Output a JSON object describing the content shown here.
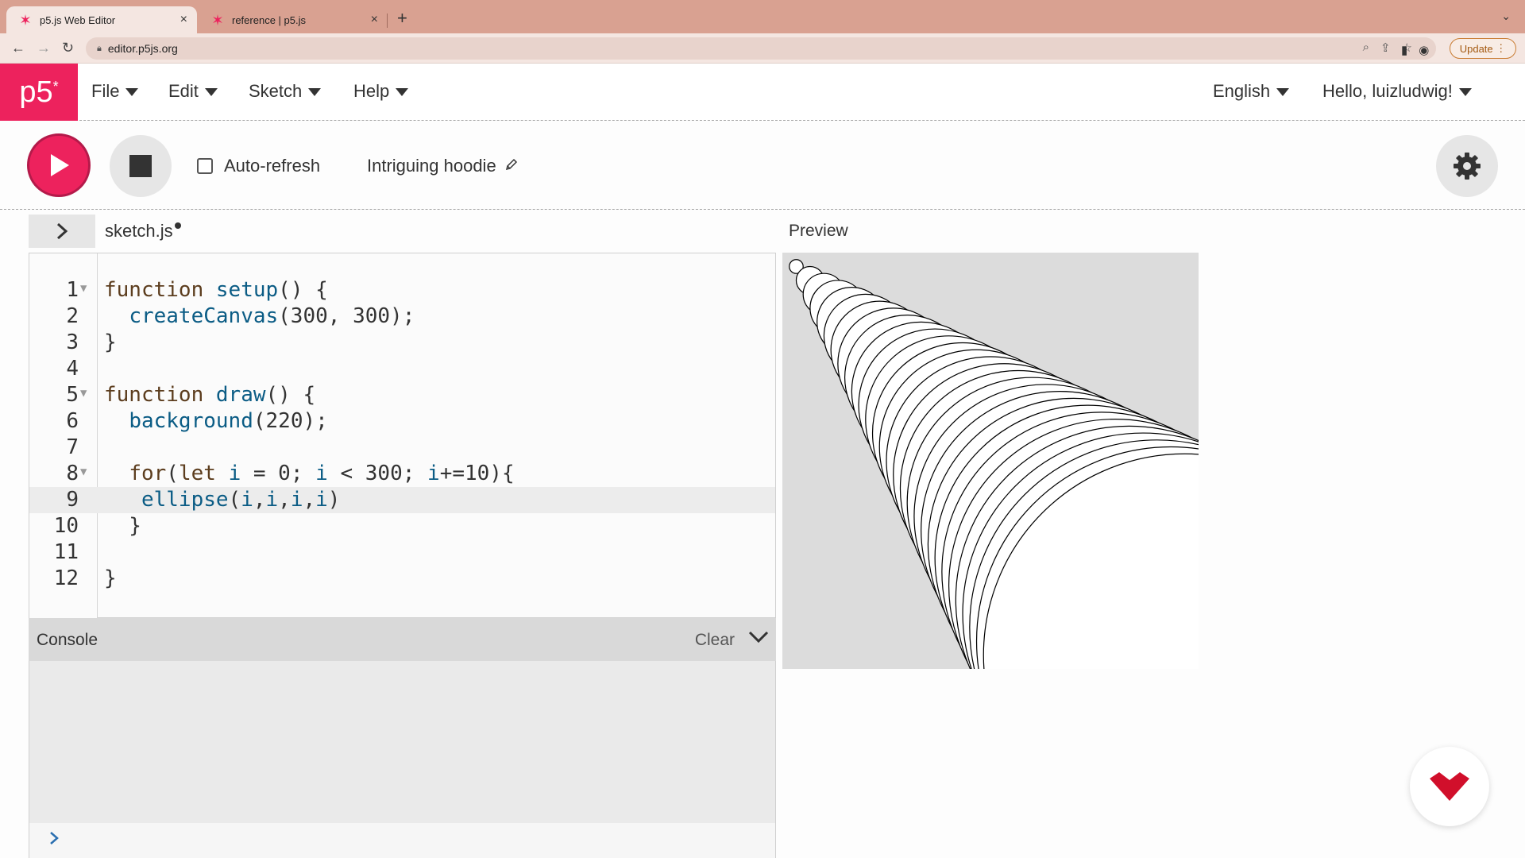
{
  "browser": {
    "tabs": [
      {
        "title": "p5.js Web Editor",
        "active": true
      },
      {
        "title": "reference | p5.js",
        "active": false
      }
    ],
    "url": "editor.p5js.org",
    "update_label": "Update"
  },
  "nav": {
    "logo": "p5",
    "logo_sup": "*",
    "menus": [
      "File",
      "Edit",
      "Sketch",
      "Help"
    ],
    "language": "English",
    "user": "Hello, luizludwig!"
  },
  "toolbar": {
    "auto_refresh_label": "Auto-refresh",
    "auto_refresh_checked": false,
    "sketch_name": "Intriguing hoodie"
  },
  "editor": {
    "file_name": "sketch.js",
    "unsaved": true,
    "active_line": 9,
    "lines": [
      {
        "n": "1",
        "fold": true,
        "code": "function setup() {"
      },
      {
        "n": "2",
        "fold": false,
        "code": "  createCanvas(300, 300);"
      },
      {
        "n": "3",
        "fold": false,
        "code": "}"
      },
      {
        "n": "4",
        "fold": false,
        "code": ""
      },
      {
        "n": "5",
        "fold": true,
        "code": "function draw() {"
      },
      {
        "n": "6",
        "fold": false,
        "code": "  background(220);"
      },
      {
        "n": "7",
        "fold": false,
        "code": ""
      },
      {
        "n": "8",
        "fold": true,
        "code": "  for(let i = 0; i < 300; i+=10){"
      },
      {
        "n": "9",
        "fold": false,
        "code": "   ellipse(i,i,i,i)"
      },
      {
        "n": "10",
        "fold": false,
        "code": "  }"
      },
      {
        "n": "11",
        "fold": false,
        "code": ""
      },
      {
        "n": "12",
        "fold": false,
        "code": "}"
      }
    ]
  },
  "console": {
    "title": "Console",
    "clear_label": "Clear"
  },
  "preview": {
    "label": "Preview",
    "canvas_size": 300,
    "background": 220,
    "ellipse_step": 10,
    "ellipse_max": 300
  },
  "colors": {
    "brand": "#ed225d",
    "tabbar": "#d9a191"
  }
}
